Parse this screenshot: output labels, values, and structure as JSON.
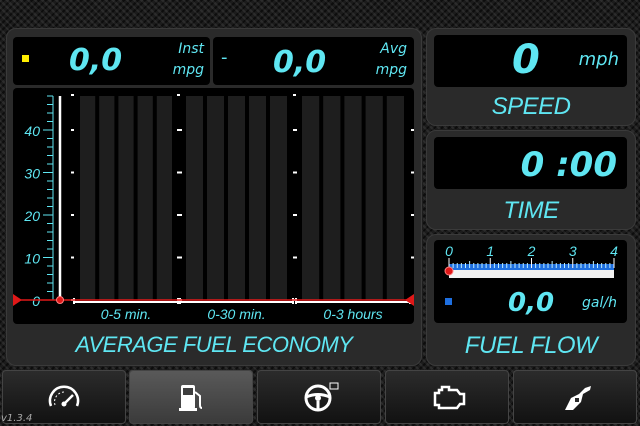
{
  "fuel_economy": {
    "inst_value": "0,0",
    "inst_label": "Inst",
    "inst_unit": "mpg",
    "avg_separator": "-",
    "avg_value": "0,0",
    "avg_label": "Avg",
    "avg_unit": "mpg",
    "title": "AVERAGE FUEL ECONOMY"
  },
  "chart_data": {
    "type": "bar",
    "yticks": [
      "0",
      "10",
      "20",
      "30",
      "40"
    ],
    "ylim": [
      0,
      48
    ],
    "groups": [
      "0-5 min.",
      "0-30 min.",
      "0-3 hours"
    ],
    "bars_per_group": 5,
    "values": [
      0,
      0,
      0,
      0,
      0,
      0,
      0,
      0,
      0,
      0,
      0,
      0,
      0,
      0,
      0
    ],
    "current_value": 0,
    "colors": {
      "bar": "#1e1e1e",
      "axis": "#ffffff",
      "marker": "#e01818",
      "text": "#5fe6f2"
    }
  },
  "speed": {
    "value": "0",
    "unit": "mph",
    "title": "SPEED"
  },
  "time": {
    "value": "0 :00",
    "title": "TIME"
  },
  "fuel_flow": {
    "scale_labels": [
      "0",
      "1",
      "2",
      "3",
      "4"
    ],
    "level_fraction": 0,
    "value": "0,0",
    "unit": "gal/h",
    "title": "FUEL FLOW"
  },
  "nav": {
    "buttons": [
      {
        "icon": "speedometer-icon",
        "active": false
      },
      {
        "icon": "fuel-pump-icon",
        "active": true
      },
      {
        "icon": "steering-wheel-icon",
        "active": false
      },
      {
        "icon": "engine-icon",
        "active": false
      },
      {
        "icon": "fuel-nozzle-icon",
        "active": false
      }
    ]
  },
  "version": "v1.3.4",
  "colors": {
    "accent": "#5fe6f2",
    "marker_yellow": "#ffee00",
    "marker_blue": "#1e6fe0",
    "marker_red": "#e01818"
  }
}
